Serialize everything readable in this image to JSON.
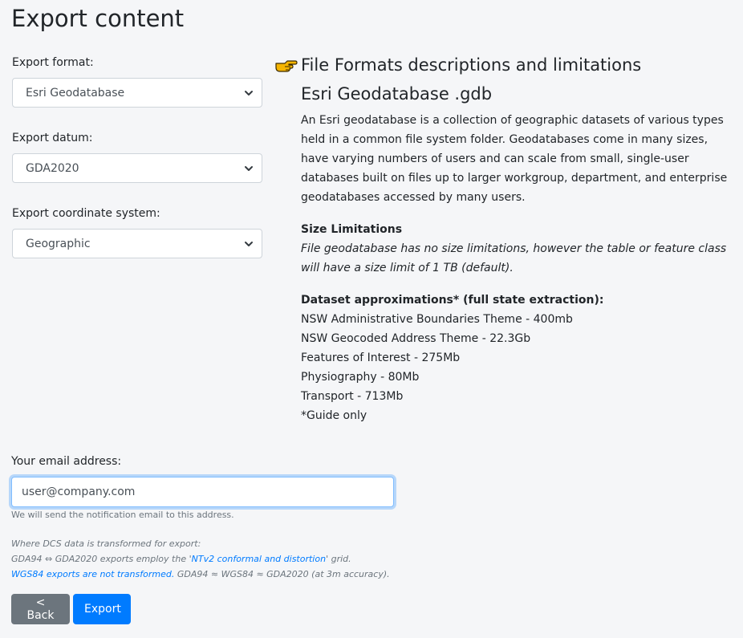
{
  "page": {
    "title": "Export content"
  },
  "form": {
    "format_label": "Export format:",
    "format_value": "Esri Geodatabase",
    "datum_label": "Export datum:",
    "datum_value": "GDA2020",
    "coord_label": "Export coordinate system:",
    "coord_value": "Geographic"
  },
  "info": {
    "heading": "File Formats descriptions and limitations",
    "format_title": "Esri Geodatabase .gdb",
    "description": "An Esri geodatabase is a collection of geographic datasets of various types held in a common file system folder. Geodatabases come in many sizes, have varying numbers of users and can scale from small, single-user databases built on files up to larger workgroup, department, and enterprise geodatabases accessed by many users.",
    "size_title": "Size Limitations",
    "size_text": "File geodatabase has no size limitations, however the table or feature class will have a size limit of 1 TB (default).",
    "dataset_title": "Dataset approximations* (full state extraction):",
    "datasets": [
      "NSW Administrative Boundaries Theme - 400mb",
      "NSW Geocoded Address Theme - 22.3Gb",
      "Features of Interest - 275Mb",
      "Physiography - 80Mb",
      "Transport - 713Mb"
    ],
    "guide_note": "*Guide only"
  },
  "email": {
    "label": "Your email address:",
    "value": "user@company.com",
    "help": "We will send the notification email to this address."
  },
  "notes": {
    "line1": "Where DCS data is transformed for export:",
    "line2_prefix": "GDA94 ⇔ GDA2020 exports employ the '",
    "line2_link": "NTv2 conformal and distortion",
    "line2_suffix": "' grid.",
    "line3_link": "WGS84 exports are not transformed.",
    "line3_suffix": " GDA94 ≈ WGS84 ≈ GDA2020 (at 3m accuracy)."
  },
  "buttons": {
    "back": "< Back",
    "export": "Export"
  },
  "colors": {
    "primary": "#007bff",
    "secondary": "#6c757d",
    "hand": "#f5b400"
  }
}
